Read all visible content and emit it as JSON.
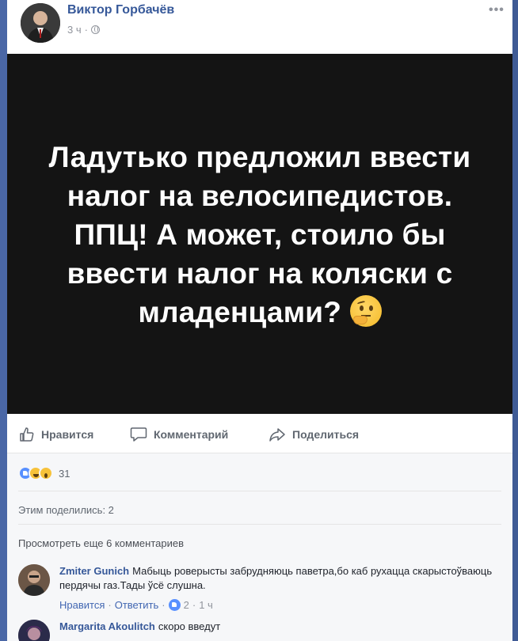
{
  "post": {
    "author": "Виктор Горбачёв",
    "time": "3 ч",
    "more_label": "•••",
    "media_text_lines": [
      "Ладутько предложил ввести",
      "налог на велосипедистов.",
      "ППЦ! А может, стоило бы",
      "ввести налог на коляски с",
      "младенцами?"
    ],
    "media_emoji": "thinking-face",
    "actions": {
      "like": "Нравится",
      "comment": "Комментарий",
      "share": "Поделиться"
    },
    "reaction_count": "31",
    "reactions": [
      "like",
      "haha",
      "wow"
    ],
    "shares_text": "Этим поделились: 2",
    "view_more_comments": "Просмотреть еще 6 комментариев"
  },
  "comments": [
    {
      "author": "Zmiter Gunich",
      "text": "Мабыць роверысты забрудняюць паветра,бо каб рухацца скарыстоўваюць пердячы газ.Тады ўсё слушна.",
      "like_label": "Нравится",
      "reply_label": "Ответить",
      "likes": "2",
      "time": "1 ч"
    },
    {
      "author": "Margarita Akoulitch",
      "text": "скоро введут"
    }
  ],
  "colors": {
    "background": "#4a67a6",
    "link": "#365899",
    "media_bg": "#141414",
    "secondary_text": "#90949c"
  }
}
